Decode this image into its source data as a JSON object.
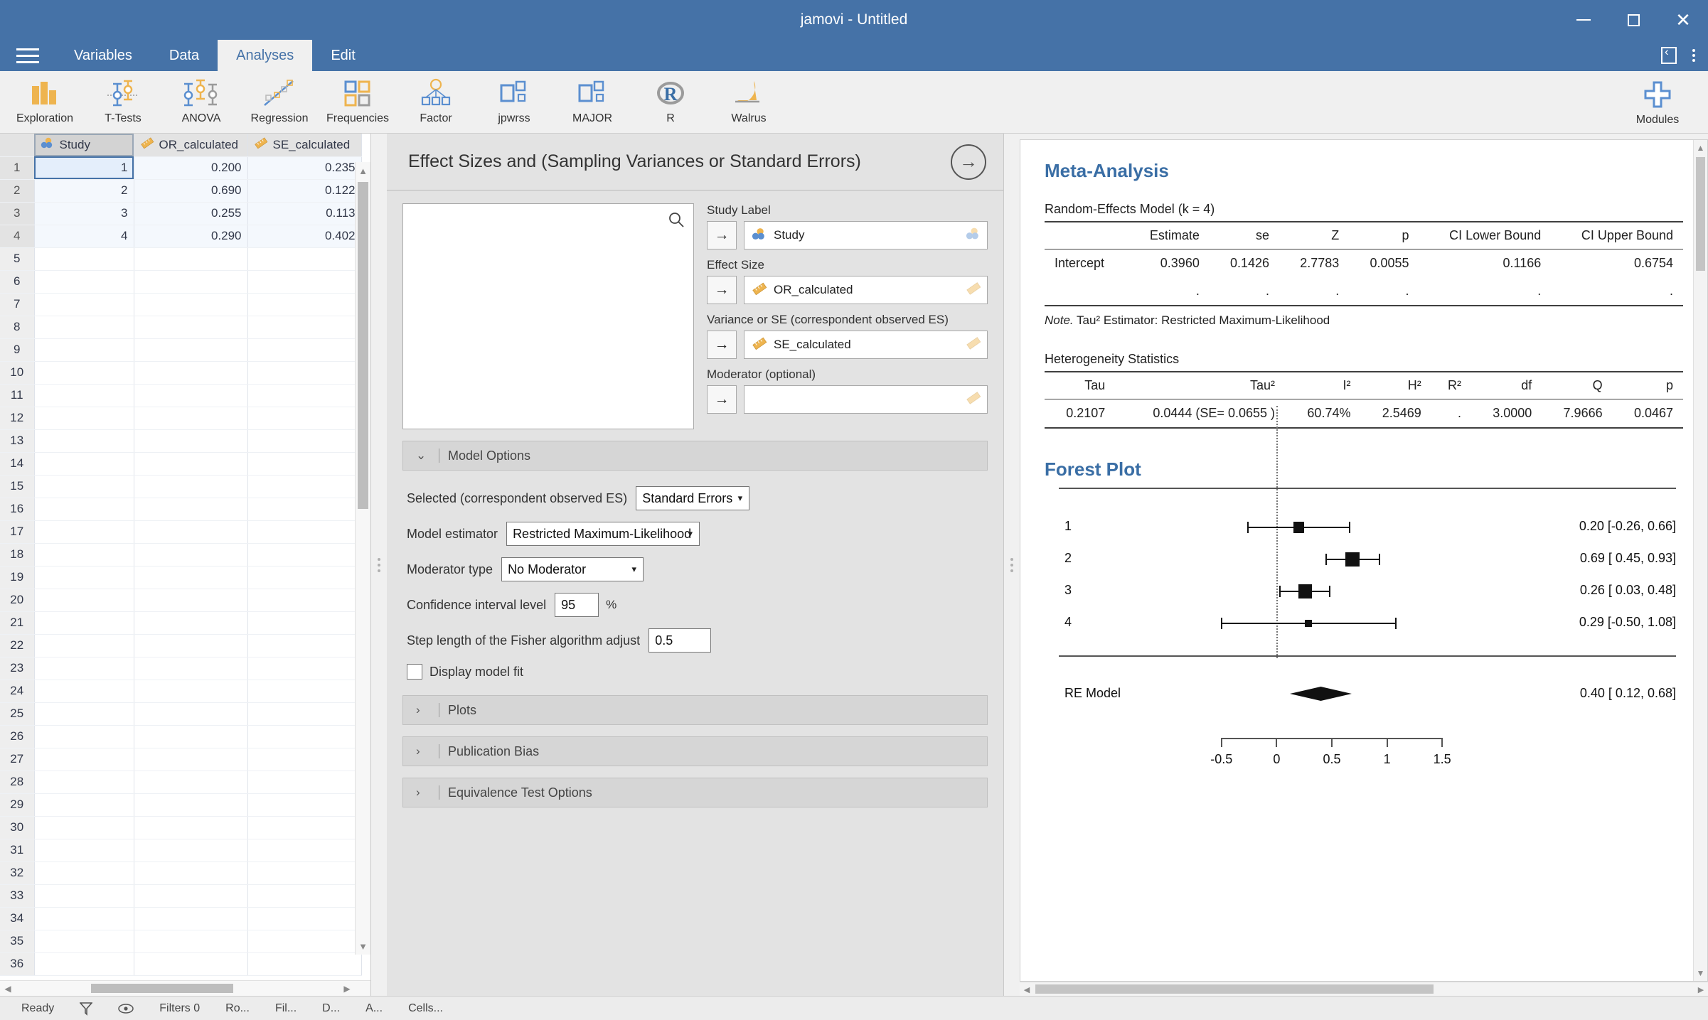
{
  "window": {
    "title": "jamovi - Untitled",
    "minimize_label": "–",
    "maximize_label": "☐",
    "close_label": "✕"
  },
  "tabs": [
    {
      "label": "Variables",
      "active": false
    },
    {
      "label": "Data",
      "active": false
    },
    {
      "label": "Analyses",
      "active": true
    },
    {
      "label": "Edit",
      "active": false
    }
  ],
  "ribbon": {
    "items": [
      {
        "label": "Exploration",
        "icon": "bar-chart-icon"
      },
      {
        "label": "T-Tests",
        "icon": "t-tests-icon"
      },
      {
        "label": "ANOVA",
        "icon": "anova-icon"
      },
      {
        "label": "Regression",
        "icon": "regression-icon"
      },
      {
        "label": "Frequencies",
        "icon": "frequencies-icon"
      },
      {
        "label": "Factor",
        "icon": "factor-icon"
      },
      {
        "label": "jpwrss",
        "icon": "jpwrss-icon"
      },
      {
        "label": "MAJOR",
        "icon": "major-icon"
      },
      {
        "label": "R",
        "icon": "r-icon"
      },
      {
        "label": "Walrus",
        "icon": "walrus-icon"
      }
    ],
    "modules": {
      "label": "Modules",
      "icon": "plus-icon"
    }
  },
  "spreadsheet": {
    "columns": [
      {
        "name": "Study",
        "type_icon": "nominal-icon"
      },
      {
        "name": "OR_calculated",
        "type_icon": "continuous-icon"
      },
      {
        "name": "SE_calculated",
        "type_icon": "continuous-icon"
      }
    ],
    "rows": [
      {
        "n": "1",
        "Study": "1",
        "OR_calculated": "0.200",
        "SE_calculated": "0.235"
      },
      {
        "n": "2",
        "Study": "2",
        "OR_calculated": "0.690",
        "SE_calculated": "0.122"
      },
      {
        "n": "3",
        "Study": "3",
        "OR_calculated": "0.255",
        "SE_calculated": "0.113"
      },
      {
        "n": "4",
        "Study": "4",
        "OR_calculated": "0.290",
        "SE_calculated": "0.402"
      }
    ],
    "empty_rows": [
      "5",
      "6",
      "7",
      "8",
      "9",
      "10",
      "11",
      "12",
      "13",
      "14",
      "15",
      "16",
      "17",
      "18",
      "19",
      "20",
      "21",
      "22",
      "23",
      "24",
      "25",
      "26",
      "27",
      "28",
      "29",
      "30",
      "31",
      "32",
      "33",
      "34",
      "35",
      "36"
    ],
    "selected_cell": {
      "row": "1",
      "column": "Study"
    }
  },
  "options_panel": {
    "title": "Effect Sizes and (Sampling Variances or Standard Errors)",
    "hide_arrow_label": "→",
    "variable_list": {
      "placeholder": "",
      "search_icon": "search-icon"
    },
    "assignments": [
      {
        "label": "Study Label",
        "value": "Study",
        "icon": "nominal-icon",
        "arrow": "→"
      },
      {
        "label": "Effect Size",
        "value": "OR_calculated",
        "icon": "continuous-icon",
        "arrow": "→"
      },
      {
        "label": "Variance or SE (correspondent observed ES)",
        "value": "SE_calculated",
        "icon": "continuous-icon",
        "arrow": "→"
      },
      {
        "label": "Moderator (optional)",
        "value": "",
        "icon": "continuous-icon",
        "arrow": "→"
      }
    ],
    "sections": [
      {
        "label": "Model Options",
        "expanded": true,
        "chevron": "⌄"
      },
      {
        "label": "Plots",
        "expanded": false,
        "chevron": "›"
      },
      {
        "label": "Publication Bias",
        "expanded": false,
        "chevron": "›"
      },
      {
        "label": "Equivalence Test Options",
        "expanded": false,
        "chevron": "›"
      }
    ],
    "model_options": {
      "selected_label": "Selected (correspondent observed ES)",
      "selected_value": "Standard Errors",
      "estimator_label": "Model estimator",
      "estimator_value": "Restricted Maximum-Likelihood",
      "moderator_label": "Moderator type",
      "moderator_value": "No Moderator",
      "ci_label": "Confidence interval level",
      "ci_value": "95",
      "ci_suffix": "%",
      "step_label": "Step length of the Fisher algorithm adjust",
      "step_value": "0.5",
      "display_fit_label": "Display model fit",
      "display_fit_checked": false
    }
  },
  "results": {
    "meta_title": "Meta-Analysis",
    "model_caption": "Random-Effects Model (k = 4)",
    "model_table": {
      "headers": [
        "",
        "Estimate",
        "se",
        "Z",
        "p",
        "CI Lower Bound",
        "CI Upper Bound"
      ],
      "rows": [
        [
          "Intercept",
          "0.3960",
          "0.1426",
          "2.7783",
          "0.0055",
          "0.1166",
          "0.6754"
        ],
        [
          "",
          ".",
          ".",
          ".",
          ".",
          ".",
          "."
        ]
      ]
    },
    "model_note_prefix": "Note.",
    "model_note": " Tau² Estimator: Restricted Maximum-Likelihood",
    "hetero_caption": "Heterogeneity Statistics",
    "hetero_table": {
      "headers": [
        "Tau",
        "Tau²",
        "I²",
        "H²",
        "R²",
        "df",
        "Q",
        "p"
      ],
      "rows": [
        [
          "0.2107",
          "0.0444 (SE= 0.0655 )",
          "60.74%",
          "2.5469",
          ".",
          "3.0000",
          "7.9666",
          "0.0467"
        ]
      ]
    },
    "forest_title": "Forest Plot"
  },
  "chart_data": {
    "type": "forest",
    "title": "Forest Plot",
    "xlabel": "",
    "ylabel": "",
    "xlim": [
      -0.75,
      1.75
    ],
    "xticks": [
      -0.5,
      0,
      0.5,
      1,
      1.5
    ],
    "xtick_labels": [
      "-0.5",
      "0",
      "0.5",
      "1",
      "1.5"
    ],
    "reference_line": 0,
    "studies": [
      {
        "label": "1",
        "estimate": 0.2,
        "ci_low": -0.26,
        "ci_high": 0.66,
        "weight": 0.62,
        "text": "0.20 [-0.26, 0.66]"
      },
      {
        "label": "2",
        "estimate": 0.69,
        "ci_low": 0.45,
        "ci_high": 0.93,
        "weight": 1.0,
        "text": "0.69 [ 0.45, 0.93]"
      },
      {
        "label": "3",
        "estimate": 0.26,
        "ci_low": 0.03,
        "ci_high": 0.48,
        "weight": 0.92,
        "text": "0.26 [ 0.03, 0.48]"
      },
      {
        "label": "4",
        "estimate": 0.29,
        "ci_low": -0.5,
        "ci_high": 1.08,
        "weight": 0.18,
        "text": "0.29 [-0.50, 1.08]"
      }
    ],
    "summary": {
      "label": "RE Model",
      "estimate": 0.4,
      "ci_low": 0.12,
      "ci_high": 0.68,
      "text": "0.40 [ 0.12, 0.68]"
    }
  },
  "statusbar": {
    "items": [
      {
        "label": "Ready",
        "icon": ""
      },
      {
        "label": "",
        "icon": "filter-icon"
      },
      {
        "label": "",
        "icon": "eye-icon"
      },
      {
        "label": "Filters 0",
        "icon": ""
      },
      {
        "label": "Ro...",
        "icon": ""
      },
      {
        "label": "Fil...",
        "icon": ""
      },
      {
        "label": "D...",
        "icon": ""
      },
      {
        "label": "A...",
        "icon": ""
      },
      {
        "label": "Cells...",
        "icon": ""
      }
    ]
  }
}
